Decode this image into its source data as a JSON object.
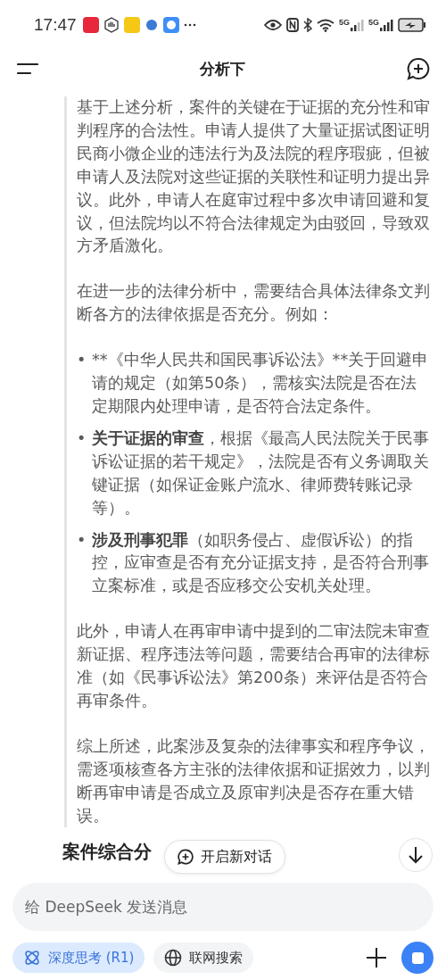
{
  "status_bar": {
    "time": "17:47",
    "network_labels": [
      "5G",
      "5G"
    ]
  },
  "header": {
    "title": "分析下"
  },
  "thinking": {
    "paragraphs_before": [
      "基于上述分析，案件的关键在于证据的充分性和审判程序的合法性。申请人提供了大量证据试图证明民商小微企业的违法行为及法院的程序瑕疵，但被申请人及法院对这些证据的关联性和证明力提出异议。此外，申请人在庭审过程中多次申请回避和复议，但法院均以不符合法律规定为由驳回，导致双方矛盾激化。",
      "在进一步的法律分析中，需要结合具体法律条文判断各方的法律依据是否充分。例如："
    ],
    "bullets": [
      {
        "marker": "•",
        "text": "**《中华人民共和国民事诉讼法》**关于回避申请的规定（如第50条），需核实法院是否在法定期限内处理申请，是否符合法定条件。"
      },
      {
        "marker": "•",
        "lead": "关于证据的审查",
        "text": "，根据《最高人民法院关于民事诉讼证据的若干规定》，法院是否有义务调取关键证据（如保证金账户流水、律师费转账记录等）。"
      },
      {
        "marker": "•",
        "lead": "涉及刑事犯罪",
        "text": "（如职务侵占、虚假诉讼）的指控，应审查是否有充分证据支持，是否符合刑事立案标准，或是否应移交公安机关处理。"
      }
    ],
    "paragraphs_after": [
      "此外，申请人在再审申请中提到的二审法院未审查新证据、程序违法等问题，需要结合再审的法律标准（如《民事诉讼法》第200条）来评估是否符合再审条件。",
      "综上所述，此案涉及复杂的法律事实和程序争议，需逐项核查各方主张的法律依据和证据效力，以判断再审申请是否成立及原审判决是否存在重大错误。"
    ]
  },
  "section_heading": "案件综合分",
  "new_chat_button": "开启新对话",
  "composer": {
    "placeholder": "给 DeepSeek 发送消息",
    "toggles": [
      {
        "kind": "deep-think",
        "label": "深度思考 (R1)",
        "selected": true
      },
      {
        "kind": "web-search",
        "label": "联网搜索",
        "selected": false
      }
    ]
  }
}
